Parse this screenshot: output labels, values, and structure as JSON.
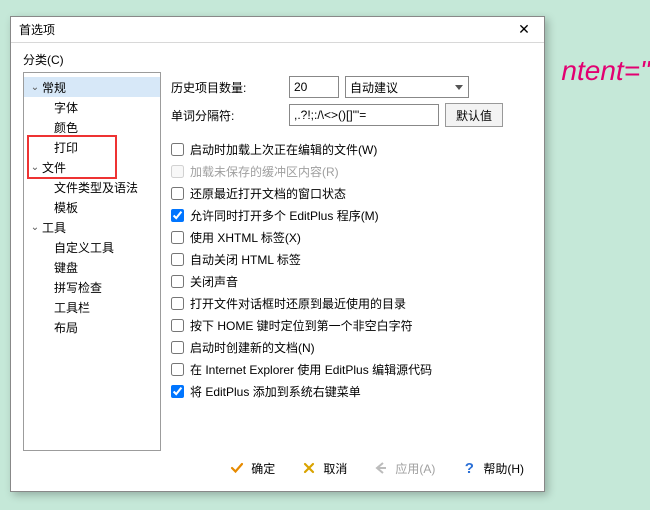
{
  "bg_code": "ntent=\"",
  "dialog": {
    "title": "首选项",
    "close": "✕",
    "categories_label": "分类(C)"
  },
  "tree": [
    {
      "label": "常规",
      "expander": "⌄",
      "cls": "top sel"
    },
    {
      "label": "字体",
      "cls": "lvl1"
    },
    {
      "label": "颜色",
      "cls": "lvl1"
    },
    {
      "label": "打印",
      "cls": "lvl1"
    },
    {
      "label": "文件",
      "expander": "⌄",
      "cls": "top"
    },
    {
      "label": "文件类型及语法",
      "cls": "lvl1"
    },
    {
      "label": "模板",
      "cls": "lvl1"
    },
    {
      "label": "工具",
      "expander": "⌄",
      "cls": "top"
    },
    {
      "label": "自定义工具",
      "cls": "lvl1"
    },
    {
      "label": "键盘",
      "cls": "lvl1"
    },
    {
      "label": "拼写检查",
      "cls": "lvl1"
    },
    {
      "label": "工具栏",
      "cls": "lvl1"
    },
    {
      "label": "布局",
      "cls": "lvl1"
    }
  ],
  "form": {
    "history_label": "历史项目数量:",
    "history_value": "20",
    "suggest_value": "自动建议",
    "delim_label": "单词分隔符:",
    "delim_value": ",.?!;:/\\<>()[]\"'=",
    "default_btn": "默认值"
  },
  "checks": [
    {
      "label": "启动时加载上次正在编辑的文件(W)",
      "checked": false
    },
    {
      "label": "加载未保存的缓冲区内容(R)",
      "checked": false,
      "disabled": true
    },
    {
      "label": "还原最近打开文档的窗口状态",
      "checked": false
    },
    {
      "label": "允许同时打开多个 EditPlus 程序(M)",
      "checked": true
    },
    {
      "label": "使用 XHTML 标签(X)",
      "checked": false
    },
    {
      "label": "自动关闭 HTML 标签",
      "checked": false
    },
    {
      "label": "关闭声音",
      "checked": false
    },
    {
      "label": "打开文件对话框时还原到最近使用的目录",
      "checked": false
    },
    {
      "label": "按下 HOME 键时定位到第一个非空白字符",
      "checked": false
    },
    {
      "label": "启动时创建新的文档(N)",
      "checked": false
    },
    {
      "label": "在 Internet Explorer 使用 EditPlus 编辑源代码",
      "checked": false
    },
    {
      "label": "将 EditPlus 添加到系统右键菜单",
      "checked": true
    }
  ],
  "buttons": {
    "ok": "确定",
    "cancel": "取消",
    "apply": "应用(A)",
    "help": "帮助(H)"
  }
}
